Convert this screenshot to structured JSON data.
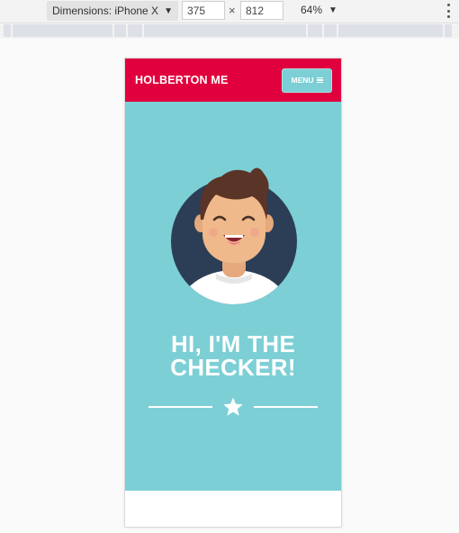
{
  "devtools": {
    "device_label": "Dimensions: iPhone X",
    "width_value": "375",
    "height_value": "812",
    "times_symbol": "×",
    "zoom_label": "64%"
  },
  "site": {
    "brand": "HOLBERTON ME",
    "menu_label": "MENU",
    "hero_line1": "HI, I'M THE",
    "hero_line2": "CHECKER!"
  },
  "colors": {
    "header_red": "#e1003e",
    "hero_teal": "#7ccfd5",
    "avatar_circle": "#2c3e55"
  },
  "icons": {
    "device_dropdown": "caret-down-icon",
    "zoom_dropdown": "caret-down-icon",
    "more": "kebab-icon",
    "menu": "hamburger-icon",
    "divider": "star-icon"
  }
}
